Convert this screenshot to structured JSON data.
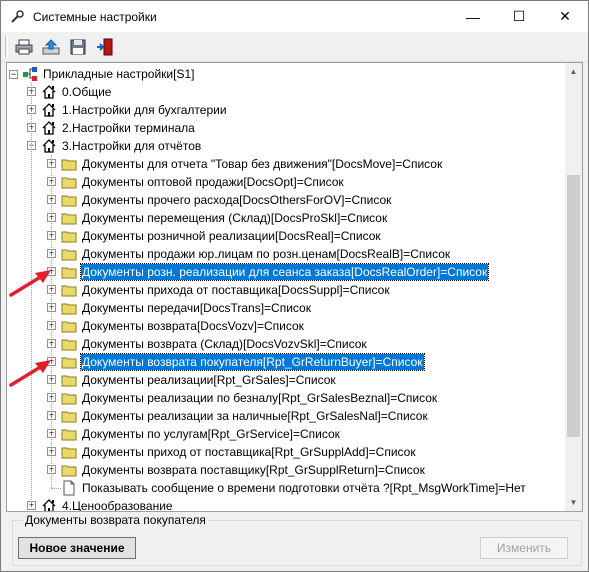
{
  "window": {
    "title": "Системные настройки",
    "minimize": "—",
    "maximize": "☐",
    "close": "✕"
  },
  "toolbar": {
    "buttons": [
      "print-icon",
      "export-icon",
      "save-icon",
      "exit-icon"
    ]
  },
  "tree": {
    "root": "Прикладные настройки[S1]",
    "items": [
      {
        "label": "0.Общие"
      },
      {
        "label": "1.Настройки для бухгалтерии"
      },
      {
        "label": "2.Настройки терминала"
      },
      {
        "label": "3.Настройки для отчётов"
      },
      {
        "label": "Документы для отчета \"Товар без движения\"[DocsMove]=Список"
      },
      {
        "label": "Документы оптовой продажи[DocsOpt]=Список"
      },
      {
        "label": "Документы прочего расхода[DocsOthersForOV]=Список"
      },
      {
        "label": "Документы перемещения (Склад)[DocsProSkl]=Список"
      },
      {
        "label": "Документы розничной реализации[DocsReal]=Список"
      },
      {
        "label": "Документы продажи юр.лицам по розн.ценам[DocsRealB]=Список"
      },
      {
        "label": "Документы розн. реализации для сеанса заказа[DocsRealOrder]=Список"
      },
      {
        "label": "Документы прихода от поставщика[DocsSuppl]=Список"
      },
      {
        "label": "Документы передачи[DocsTrans]=Список"
      },
      {
        "label": "Документы возврата[DocsVozv]=Список"
      },
      {
        "label": "Документы возврата (Склад)[DocsVozvSkl]=Список"
      },
      {
        "label": "Документы возврата покупателя[Rpt_GrReturnBuyer]=Список"
      },
      {
        "label": "Документы реализации[Rpt_GrSales]=Список"
      },
      {
        "label": "Документы реализации по безналу[Rpt_GrSalesBeznal]=Список"
      },
      {
        "label": "Документы реализации за наличные[Rpt_GrSalesNal]=Список"
      },
      {
        "label": "Документы по услугам[Rpt_GrService]=Список"
      },
      {
        "label": "Документы приход от поставщика[Rpt_GrSupplAdd]=Список"
      },
      {
        "label": "Документы возврата поставщику[Rpt_GrSupplReturn]=Список"
      },
      {
        "label": "Показывать сообщение о времени подготовки отчёта ?[Rpt_MsgWorkTime]=Нет"
      },
      {
        "label": "4.Ценообразование"
      }
    ]
  },
  "details": {
    "group_title": "Документы возврата покупателя",
    "new_value_button": "Новое значение",
    "edit_button": "Изменить"
  },
  "colors": {
    "selection": "#0078d7",
    "arrow": "#e0202c",
    "folder": "#e8d96a"
  }
}
